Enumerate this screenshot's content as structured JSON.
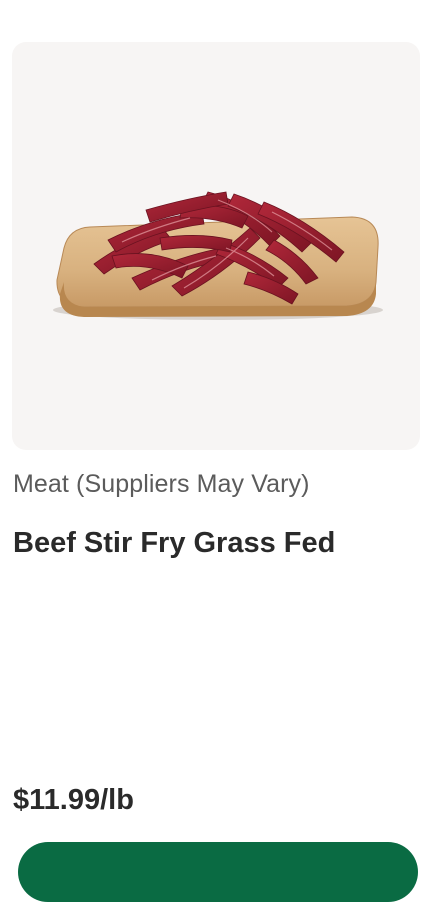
{
  "product": {
    "image_alt": "Beef stir fry strips on a wooden cutting board",
    "supplier": "Meat (Suppliers May Vary)",
    "name": "Beef Stir Fry Grass Fed",
    "price": "$11.99/lb"
  },
  "colors": {
    "image_bg": "#f7f5f4",
    "text_primary": "#2a2a2a",
    "text_secondary": "#5b5b5b",
    "cta_green": "#0a6b43"
  }
}
